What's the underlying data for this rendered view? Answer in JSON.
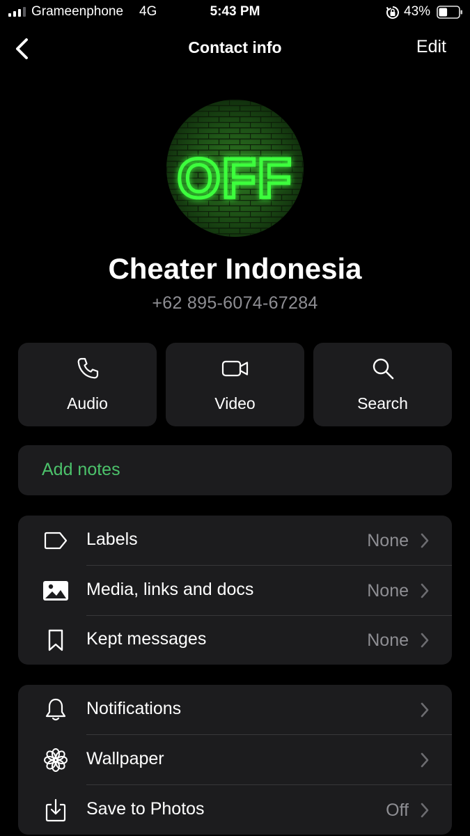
{
  "status_bar": {
    "carrier": "Grameenphone",
    "network": "4G",
    "time": "5:43 PM",
    "battery_percent": "43%",
    "battery_level": 0.43
  },
  "nav": {
    "back_icon": "chevron-left-icon",
    "title": "Contact info",
    "edit_label": "Edit"
  },
  "contact": {
    "avatar_text": "OFF",
    "name": "Cheater Indonesia",
    "phone": "+62 895-6074-67284"
  },
  "actions": [
    {
      "label": "Audio",
      "icon": "phone-icon"
    },
    {
      "label": "Video",
      "icon": "video-camera-icon"
    },
    {
      "label": "Search",
      "icon": "search-icon"
    }
  ],
  "notes": {
    "label": "Add notes"
  },
  "group1": [
    {
      "label": "Labels",
      "value": "None",
      "icon": "label-tag-icon"
    },
    {
      "label": "Media, links and docs",
      "value": "None",
      "icon": "image-icon"
    },
    {
      "label": "Kept messages",
      "value": "None",
      "icon": "bookmark-icon"
    }
  ],
  "group2": [
    {
      "label": "Notifications",
      "value": "",
      "icon": "bell-icon"
    },
    {
      "label": "Wallpaper",
      "value": "",
      "icon": "flower-icon"
    },
    {
      "label": "Save to Photos",
      "value": "Off",
      "icon": "download-icon"
    }
  ],
  "colors": {
    "background": "#000000",
    "card": "#1c1c1e",
    "accent_green": "#4cc26b",
    "secondary_text": "#8e8e93",
    "separator": "#38383a",
    "neon_green": "#3dff3d"
  }
}
